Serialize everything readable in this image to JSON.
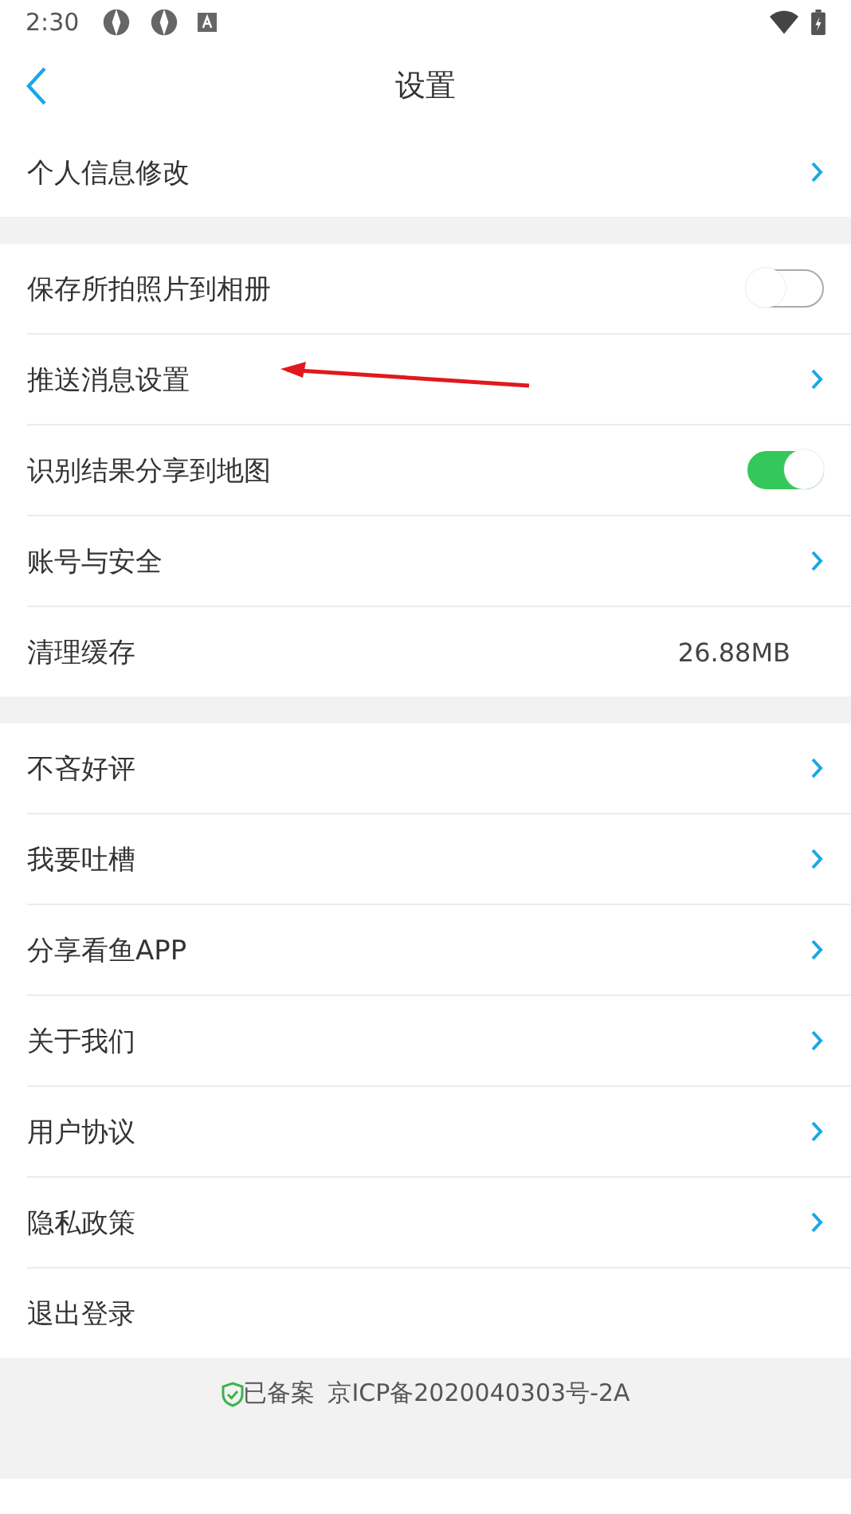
{
  "status_bar": {
    "time": "2:30"
  },
  "header": {
    "title": "设置"
  },
  "sections": [
    [
      {
        "kind": "link",
        "label": "个人信息修改"
      }
    ],
    [
      {
        "kind": "toggle",
        "label": "保存所拍照片到相册",
        "on": false
      },
      {
        "kind": "link",
        "label": "推送消息设置"
      },
      {
        "kind": "toggle",
        "label": "识别结果分享到地图",
        "on": true
      },
      {
        "kind": "link",
        "label": "账号与安全"
      },
      {
        "kind": "value",
        "label": "清理缓存",
        "value": "26.88MB"
      }
    ],
    [
      {
        "kind": "link",
        "label": "不吝好评"
      },
      {
        "kind": "link",
        "label": "我要吐槽"
      },
      {
        "kind": "link",
        "label": "分享看鱼APP"
      },
      {
        "kind": "link",
        "label": "关于我们"
      },
      {
        "kind": "link",
        "label": "用户协议"
      },
      {
        "kind": "link",
        "label": "隐私政策"
      },
      {
        "kind": "plain",
        "label": "退出登录"
      }
    ]
  ],
  "footer": {
    "verified": "已备案",
    "icp": "京ICP备2020040303号-2A"
  }
}
